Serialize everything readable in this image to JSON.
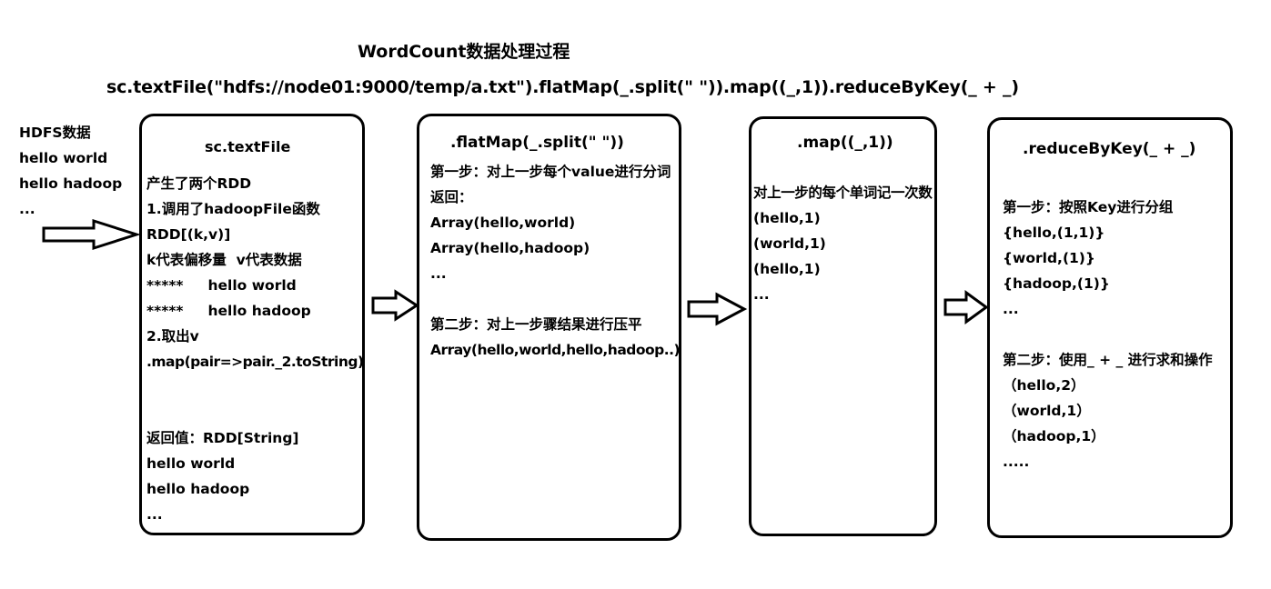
{
  "title": "WordCount数据处理过程",
  "code": "sc.textFile(\"hdfs://node01:9000/temp/a.txt\").flatMap(_.split(\" \")).map((_,1)).reduceByKey(_ + _)",
  "hdfs": {
    "lines": [
      "HDFS数据",
      "hello world",
      "hello hadoop",
      "..."
    ]
  },
  "stages": [
    {
      "title": "sc.textFile",
      "lines": [
        "产生了两个RDD",
        "1.调用了hadoopFile函数",
        "RDD[(k,v)]",
        "k代表偏移量  v代表数据",
        "*****     hello world",
        "*****     hello hadoop",
        "2.取出v",
        ".map(pair=>pair._2.toString)",
        "",
        "",
        "返回值：RDD[String]",
        "hello world",
        "hello hadoop",
        "..."
      ]
    },
    {
      "title": ".flatMap(_.split(\" \"))",
      "lines": [
        "第一步：对上一步每个value进行分词",
        "返回：",
        "Array(hello,world)",
        "Array(hello,hadoop)",
        "...",
        "",
        "第二步：对上一步骤结果进行压平",
        "Array(hello,world,hello,hadoop..)"
      ]
    },
    {
      "title": ".map((_,1))",
      "lines": [
        "对上一步的每个单词记一次数",
        "(hello,1)",
        "(world,1)",
        "(hello,1)",
        "..."
      ]
    },
    {
      "title": ".reduceByKey(_ + _)",
      "lines": [
        "第一步：按照Key进行分组",
        "{hello,(1,1)}",
        "{world,(1)}",
        "{hadoop,(1)}",
        "...",
        "",
        "第二步：使用_ + _ 进行求和操作",
        "（hello,2）",
        "（world,1）",
        "（hadoop,1）",
        "....."
      ]
    }
  ]
}
